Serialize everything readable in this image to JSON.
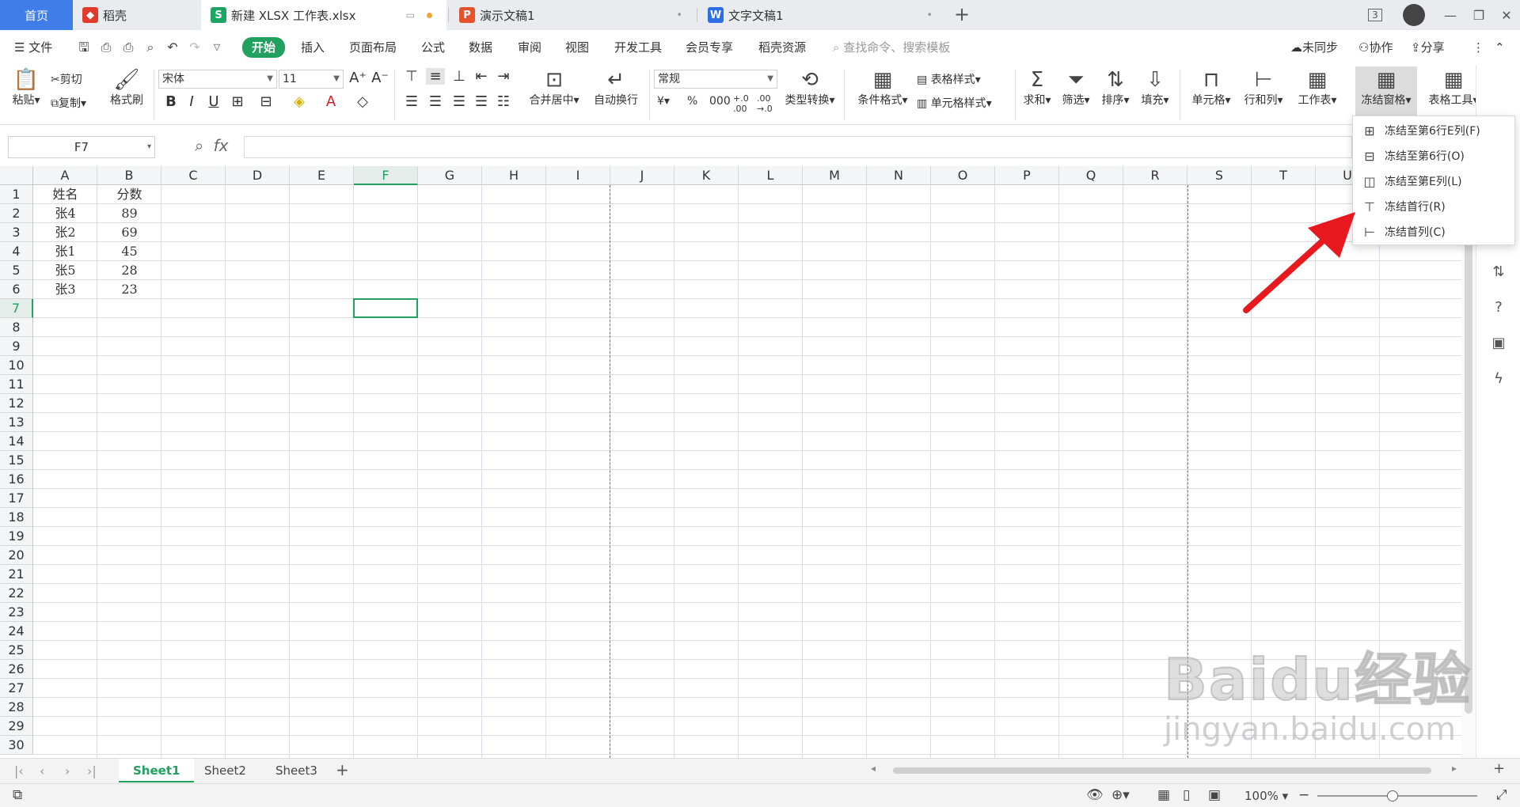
{
  "tabs": {
    "home": "首页",
    "daoke": "稻壳",
    "xlsx": "新建 XLSX 工作表.xlsx",
    "ppt": "演示文稿1",
    "doc": "文字文稿1",
    "new_tab": "+",
    "window_count": "3"
  },
  "menu": {
    "file": "文件",
    "items": [
      "开始",
      "插入",
      "页面布局",
      "公式",
      "数据",
      "审阅",
      "视图",
      "开发工具",
      "会员专享",
      "稻壳资源"
    ],
    "search_placeholder": "查找命令、搜索模板",
    "unsync": "未同步",
    "collab": "协作",
    "share": "分享"
  },
  "ribbon": {
    "paste": "粘贴",
    "cut": "剪切",
    "copy": "复制",
    "format_painter": "格式刷",
    "font_name": "宋体",
    "font_size": "11",
    "merge_center": "合并居中",
    "auto_wrap": "自动换行",
    "number_format": "常规",
    "type_convert": "类型转换",
    "cond_format": "条件格式",
    "table_style": "表格样式",
    "cell_style": "单元格样式",
    "sum": "求和",
    "filter": "筛选",
    "sort": "排序",
    "fill": "填充",
    "cell": "单元格",
    "row_col": "行和列",
    "worksheet": "工作表",
    "freeze_panes": "冻结窗格",
    "table_tools": "表格工具"
  },
  "formula_bar": {
    "name_box": "F7",
    "fx": "fx",
    "value": ""
  },
  "grid": {
    "columns": [
      "A",
      "B",
      "C",
      "D",
      "E",
      "F",
      "G",
      "H",
      "I",
      "J",
      "K",
      "L",
      "M",
      "N",
      "O",
      "P",
      "Q",
      "R",
      "S",
      "T",
      "U"
    ],
    "rows": [
      "1",
      "2",
      "3",
      "4",
      "5",
      "6",
      "7",
      "8",
      "9",
      "10",
      "11",
      "12",
      "13",
      "14",
      "15",
      "16",
      "17",
      "18",
      "19",
      "20",
      "21",
      "22",
      "23",
      "24",
      "25",
      "26",
      "27",
      "28",
      "29",
      "30"
    ],
    "header": [
      "姓名",
      "分数"
    ],
    "data": [
      [
        "张4",
        "89"
      ],
      [
        "张2",
        "69"
      ],
      [
        "张1",
        "45"
      ],
      [
        "张5",
        "28"
      ],
      [
        "张3",
        "23"
      ]
    ],
    "active_cell": "F7"
  },
  "freeze_menu": {
    "items": [
      "冻结至第6行E列(F)",
      "冻结至第6行(O)",
      "冻结至第E列(L)",
      "冻结首行(R)",
      "冻结首列(C)"
    ]
  },
  "sheets": {
    "tabs": [
      "Sheet1",
      "Sheet2",
      "Sheet3"
    ],
    "active": "Sheet1",
    "add": "+"
  },
  "status": {
    "zoom": "100%"
  },
  "watermark": {
    "logo": "Baidu经验",
    "url": "jingyan.baidu.com"
  },
  "colors": {
    "accent": "#22a060",
    "home_tab": "#3f7ee8",
    "arrow": "#e8191e"
  }
}
